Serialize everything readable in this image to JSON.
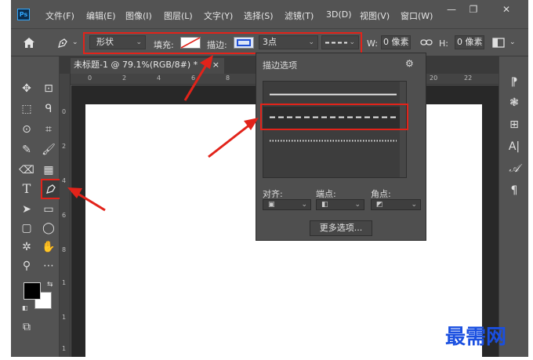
{
  "app": {
    "logo": "Ps"
  },
  "menu": [
    "文件(F)",
    "编辑(E)",
    "图像(I)",
    "图层(L)",
    "文字(Y)",
    "选择(S)",
    "滤镜(T)",
    "3D(D)",
    "视图(V)",
    "窗口(W)"
  ],
  "window_controls": {
    "minimize": "—",
    "restore": "❐",
    "close": "✕"
  },
  "options": {
    "home_icon": "home-icon",
    "pen_icon": "pen-icon",
    "mode_value": "形状",
    "fill_label": "填充:",
    "stroke_label": "描边:",
    "stroke_width": "3点",
    "w_label": "W:",
    "w_value": "0 像素",
    "link_icon": "link-icon",
    "h_label": "H:",
    "h_value": "0 像素"
  },
  "document": {
    "tab_title": "未标题-1 @ 79.1%(RGB/8#) *",
    "close": "×",
    "ruler_h": [
      "0",
      "2",
      "4",
      "6",
      "8",
      "20",
      "22"
    ],
    "ruler_v": [
      "0",
      "2",
      "4",
      "6",
      "8",
      "1",
      "1",
      "1"
    ]
  },
  "stroke_popup": {
    "title": "描边选项",
    "gear_icon": "gear-icon",
    "align_label": "对齐:",
    "caps_label": "端点:",
    "corners_label": "角点:",
    "more_button": "更多选项..."
  },
  "right_panel_icons": [
    "paragraph-styles-icon",
    "3d-icon",
    "grid-icon",
    "character-icon",
    "glyph-icon",
    "paragraph-icon"
  ],
  "watermark": "最需网",
  "colors": {
    "highlight": "#e2231a",
    "panel": "#535353",
    "canvas_bg": "#282828",
    "watermark": "#1a4fe0"
  }
}
